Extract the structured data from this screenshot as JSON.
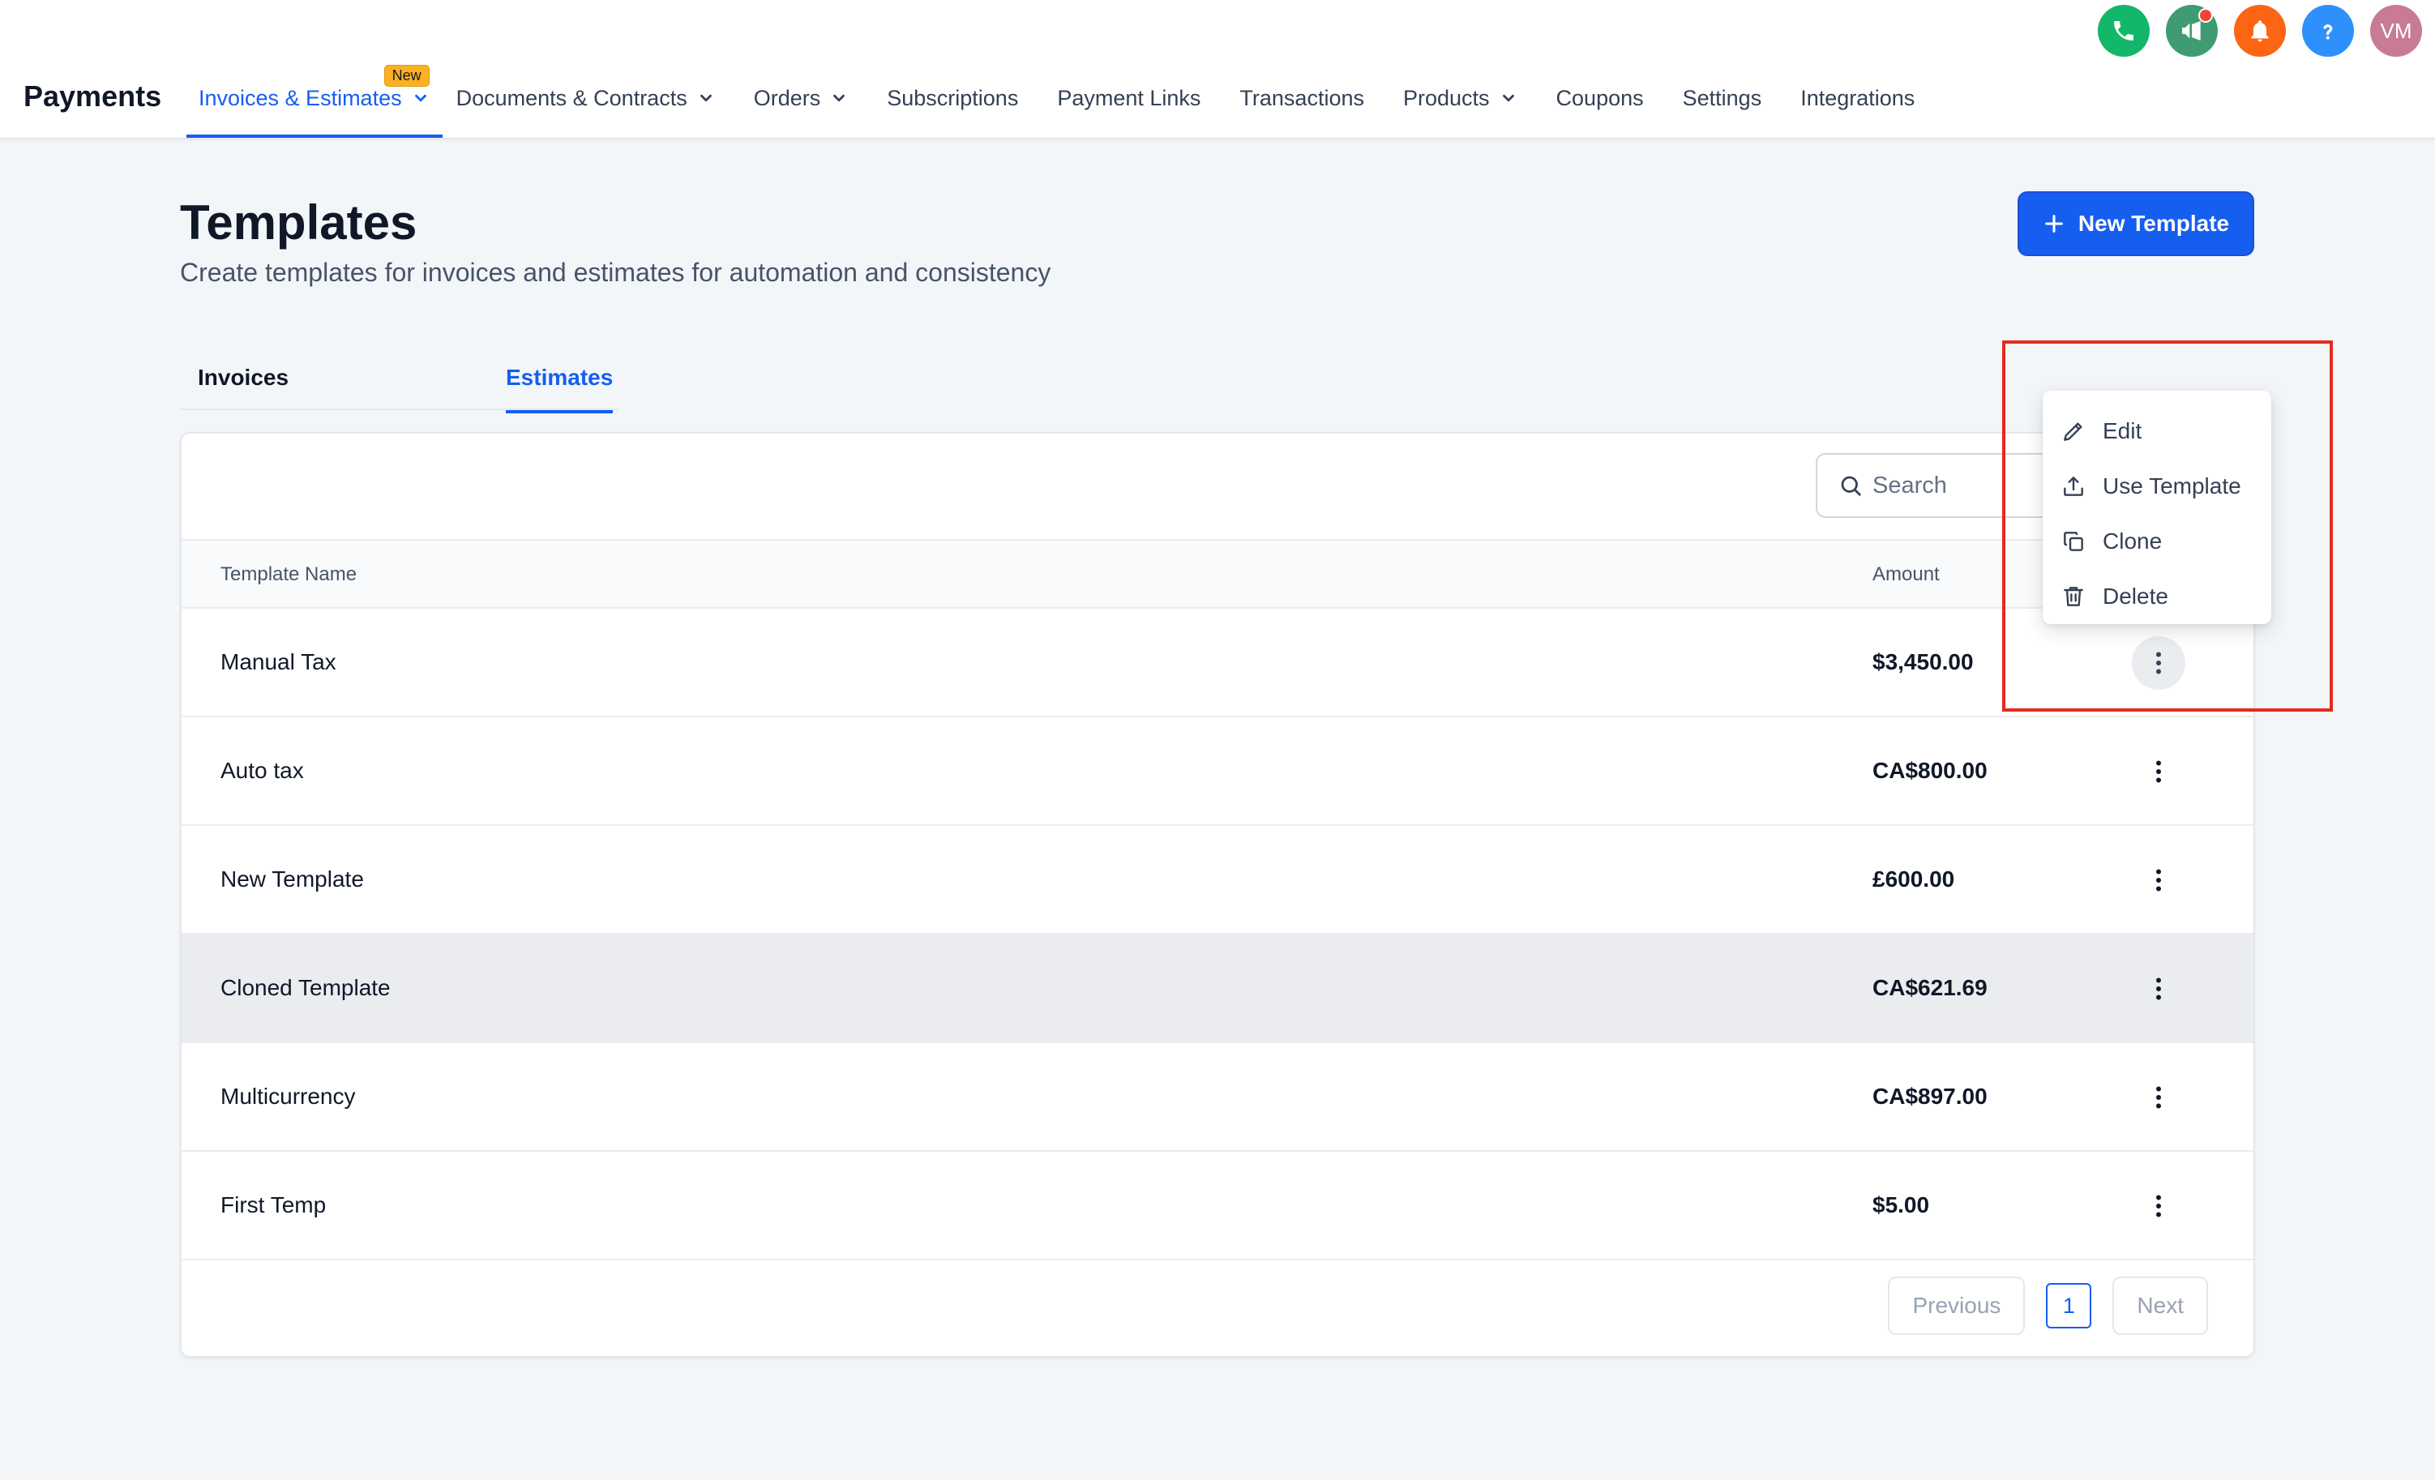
{
  "app": {
    "title": "Payments"
  },
  "nav": {
    "items": [
      {
        "label": "Invoices & Estimates",
        "has_dropdown": true,
        "active": true,
        "badge": "New"
      },
      {
        "label": "Documents & Contracts",
        "has_dropdown": true
      },
      {
        "label": "Orders",
        "has_dropdown": true
      },
      {
        "label": "Subscriptions"
      },
      {
        "label": "Payment Links"
      },
      {
        "label": "Transactions"
      },
      {
        "label": "Products",
        "has_dropdown": true
      },
      {
        "label": "Coupons"
      },
      {
        "label": "Settings"
      },
      {
        "label": "Integrations"
      }
    ]
  },
  "header_icons": {
    "phone_color": "#12b76a",
    "announce_color": "#3f9c72",
    "bell_color": "#fb6514",
    "help_color": "#2e90fa",
    "avatar_initials": "VM",
    "avatar_color": "#c97b96"
  },
  "page": {
    "title": "Templates",
    "subtitle": "Create templates for invoices and estimates for automation and consistency",
    "new_button_label": "New Template"
  },
  "tabs": [
    {
      "label": "Invoices",
      "active": false
    },
    {
      "label": "Estimates",
      "active": true
    }
  ],
  "search": {
    "placeholder": "Search"
  },
  "table": {
    "columns": {
      "name": "Template Name",
      "amount": "Amount"
    },
    "rows": [
      {
        "name": "Manual Tax",
        "amount": "$3,450.00"
      },
      {
        "name": "Auto tax",
        "amount": "CA$800.00"
      },
      {
        "name": "New Template",
        "amount": "£600.00"
      },
      {
        "name": "Cloned Template",
        "amount": "CA$621.69"
      },
      {
        "name": "Multicurrency",
        "amount": "CA$897.00"
      },
      {
        "name": "First Temp",
        "amount": "$5.00"
      }
    ]
  },
  "pagination": {
    "previous": "Previous",
    "current": "1",
    "next": "Next"
  },
  "context_menu": {
    "items": [
      {
        "label": "Edit",
        "icon": "pencil-icon"
      },
      {
        "label": "Use Template",
        "icon": "upload-icon"
      },
      {
        "label": "Clone",
        "icon": "copy-icon"
      },
      {
        "label": "Delete",
        "icon": "trash-icon"
      }
    ]
  },
  "colors": {
    "primary": "#155eef",
    "highlight": "#e8291c"
  }
}
